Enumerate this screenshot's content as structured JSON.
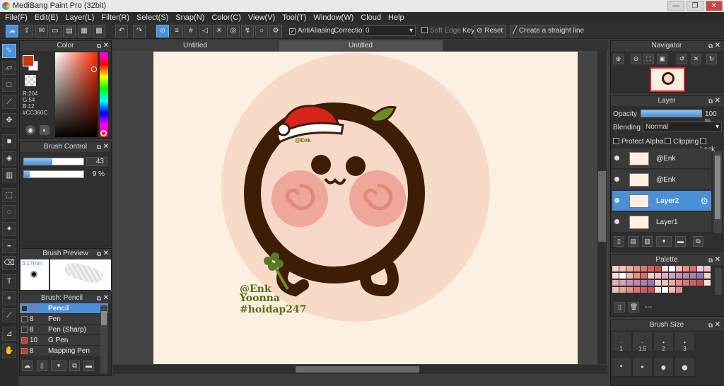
{
  "app": {
    "title": "MediBang Paint Pro (32bit)",
    "min": "—",
    "max": "❐",
    "close": "✕"
  },
  "menu": [
    "File(F)",
    "Edit(E)",
    "Layer(L)",
    "Filter(R)",
    "Select(S)",
    "Snap(N)",
    "Color(C)",
    "View(V)",
    "Tool(T)",
    "Window(W)",
    "Cloud",
    "Help"
  ],
  "toolbar": {
    "antialias": "AntiAliasing",
    "correction_label": "Correction",
    "correction_value": "0",
    "soft_edge": "Soft Edge",
    "key": "Key",
    "reset": "Reset",
    "straight": "Create a straight line"
  },
  "tabs": [
    "Untitled",
    "Untitled"
  ],
  "color": {
    "title": "Color",
    "r": "R:204",
    "g": "G:54",
    "b": "B:12",
    "hex": "#CC360C",
    "main": "#cc360c"
  },
  "brush_control": {
    "title": "Brush Control",
    "size": "43",
    "opacity": "9 %",
    "size_frac": 0.48,
    "opacity_frac": 0.09
  },
  "brush_preview": {
    "title": "Brush Preview",
    "size": "3.17mm"
  },
  "brush_list": {
    "title": "Brush: Pencil",
    "items": [
      {
        "n": "43",
        "name": "Pencil",
        "color": "#333333"
      },
      {
        "n": "8",
        "name": "Pen",
        "color": "#333333"
      },
      {
        "n": "8",
        "name": "Pen (Sharp)",
        "color": "#333333"
      },
      {
        "n": "10",
        "name": "G Pen",
        "color": "#e03030"
      },
      {
        "n": "8",
        "name": "Mapping Pen",
        "color": "#e03030"
      }
    ]
  },
  "navigator": {
    "title": "Navigator"
  },
  "layer": {
    "title": "Layer",
    "opacity_label": "Opacity",
    "opacity_value": "100 %",
    "blending_label": "Blending",
    "blending_value": "Normal",
    "protect": "Protect Alpha",
    "clipping": "Clipping",
    "lock": "Lock",
    "items": [
      {
        "name": "@Enk"
      },
      {
        "name": "@Enk"
      },
      {
        "name": "Layer2"
      },
      {
        "name": "Layer1"
      }
    ]
  },
  "palette": {
    "title": "Palette",
    "empty": "---"
  },
  "brush_size": {
    "title": "Brush Size",
    "labels": [
      "1",
      "1.5",
      "2",
      "3"
    ]
  },
  "art": {
    "tag": "@Enk",
    "lines": [
      "@Enk",
      "Yoonna",
      "#hoidap247"
    ],
    "outline": "#3d1c08",
    "face": "#f7d8c8",
    "cheek": "#eea79a",
    "hat": "#d4241c",
    "bg_circle": "#f7dac7"
  }
}
